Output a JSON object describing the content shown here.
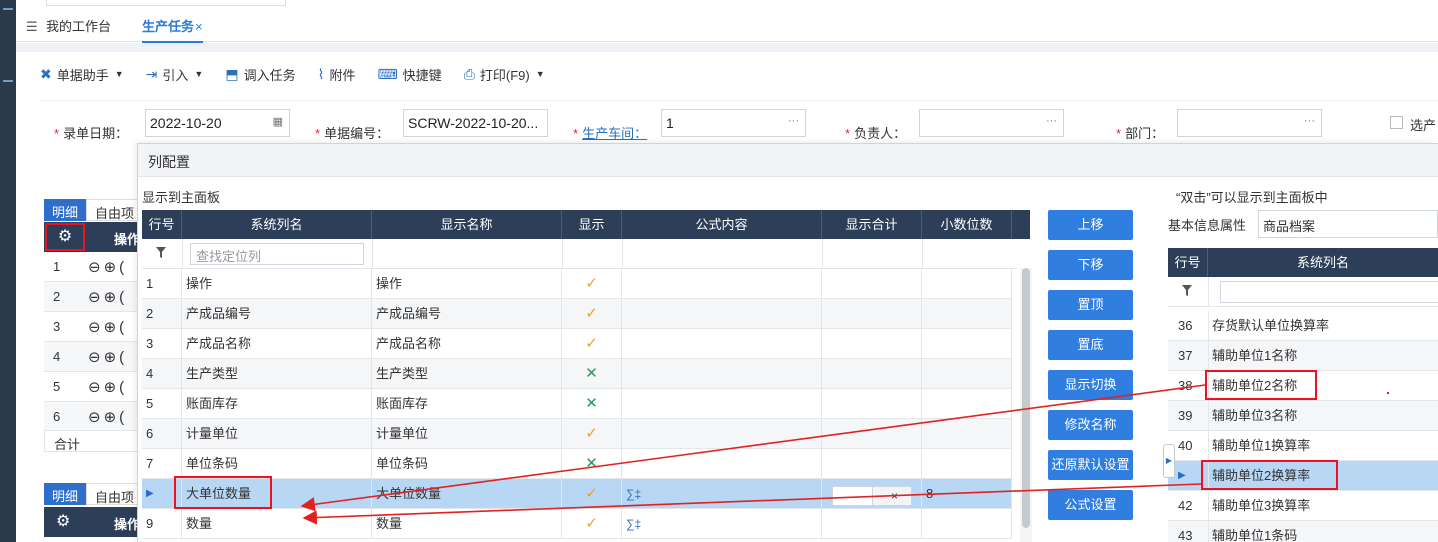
{
  "tabs": [
    {
      "label": "我的工作台"
    },
    {
      "label": "生产任务",
      "close": "×"
    }
  ],
  "toolbar": {
    "doc_assistant": "单据助手",
    "import": "引入",
    "call_task": "调入任务",
    "attachment": "附件",
    "shortcuts": "快捷键",
    "print": "打印(F9)"
  },
  "form": {
    "entry_date_label": "录单日期：",
    "entry_date_value": "2022-10-20",
    "doc_no_label": "单据编号：",
    "doc_no_value": "SCRW-2022-10-20...",
    "workshop_label": "生产车间：",
    "workshop_value": "1",
    "owner_label": "负责人：",
    "dept_label": "部门：",
    "select_label": "选产",
    "required_mark": "*",
    "more": "···"
  },
  "bg": {
    "tab_detail": "明细",
    "tab_free": "自由项",
    "op_header": "操作",
    "row_numbers": [
      "1",
      "2",
      "3",
      "4",
      "5",
      "6"
    ],
    "ops": "⊖⊕(",
    "sum": "合计",
    "tab_detail2": "明细",
    "tab_free2": "自由项",
    "op_header2": "操作"
  },
  "dialog": {
    "title": "列配置",
    "left_section": "显示到主面板",
    "headers": [
      "行号",
      "系统列名",
      "显示名称",
      "显示",
      "公式内容",
      "显示合计",
      "小数位数"
    ],
    "search_placeholder": "查找定位列",
    "rows": [
      {
        "no": "1",
        "sys": "操作",
        "disp": "操作",
        "show": "check"
      },
      {
        "no": "2",
        "sys": "产成品编号",
        "disp": "产成品编号",
        "show": "check"
      },
      {
        "no": "3",
        "sys": "产成品名称",
        "disp": "产成品名称",
        "show": "check"
      },
      {
        "no": "4",
        "sys": "生产类型",
        "disp": "生产类型",
        "show": "cross"
      },
      {
        "no": "5",
        "sys": "账面库存",
        "disp": "账面库存",
        "show": "cross"
      },
      {
        "no": "6",
        "sys": "计量单位",
        "disp": "计量单位",
        "show": "check"
      },
      {
        "no": "7",
        "sys": "单位条码",
        "disp": "单位条码",
        "show": "cross"
      },
      {
        "no": "▶",
        "sys": "大单位数量",
        "disp": "大单位数量",
        "show": "check",
        "formula": "∑‡",
        "sum_x": "×",
        "decimals": "8"
      },
      {
        "no": "9",
        "sys": "数量",
        "disp": "数量",
        "show": "check",
        "formula": "∑‡"
      }
    ],
    "buttons": [
      "上移",
      "下移",
      "置顶",
      "置底",
      "显示切换",
      "修改名称",
      "还原默认设置",
      "公式设置"
    ],
    "right_hint": "“双击”可以显示到主面板中",
    "attr_label": "基本信息属性",
    "attr_value": "商品档案",
    "right_headers": [
      "行号",
      "系统列名"
    ],
    "right_rows": [
      {
        "no": "36",
        "name": "存货默认单位换算率"
      },
      {
        "no": "37",
        "name": "辅助单位1名称"
      },
      {
        "no": "38",
        "name": "辅助单位2名称"
      },
      {
        "no": "39",
        "name": "辅助单位3名称"
      },
      {
        "no": "40",
        "name": "辅助单位1换算率"
      },
      {
        "no": "▶",
        "name": "辅助单位2换算率"
      },
      {
        "no": "42",
        "name": "辅助单位3换算率"
      },
      {
        "no": "43",
        "name": "辅助单位1条码"
      }
    ]
  },
  "colors": {
    "header_bg": "#2d3e58",
    "accent": "#2f7ee0",
    "selected_row": "#b8d7f5",
    "annotation": "#e12222",
    "check": "#f0a020",
    "cross": "#2a9a5a"
  }
}
